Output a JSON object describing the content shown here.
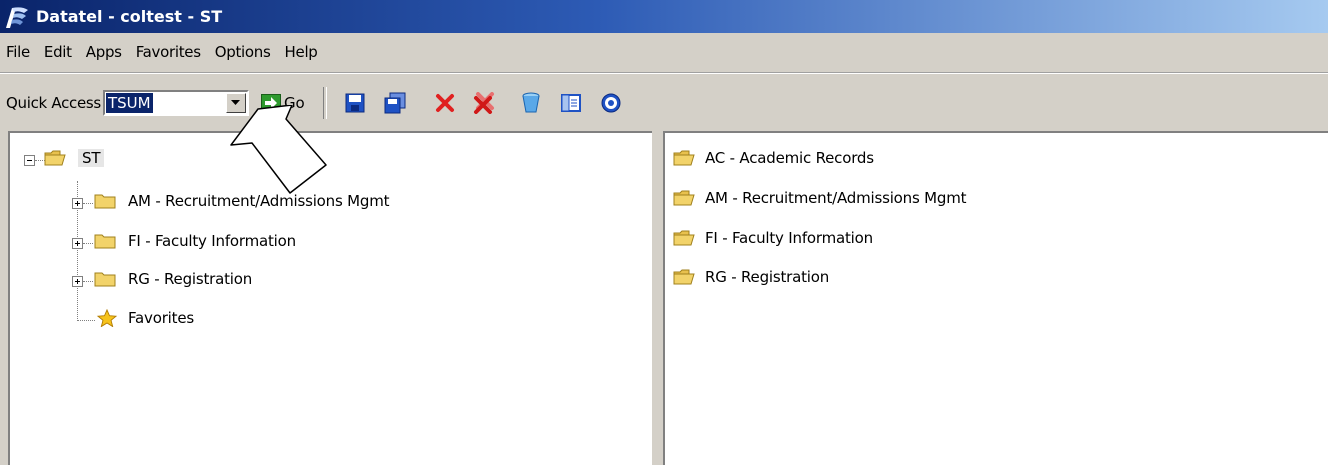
{
  "window": {
    "title": "Datatel - coltest - ST"
  },
  "menu": [
    "File",
    "Edit",
    "Apps",
    "Favorites",
    "Options",
    "Help"
  ],
  "toolbar": {
    "quick_access_label": "Quick Access",
    "quick_access_value": "TSUM",
    "go_label": "Go",
    "icons": [
      "save-icon",
      "save-all-icon",
      "cancel-icon",
      "cancel-all-icon",
      "delete-icon",
      "view-icon",
      "help-icon"
    ]
  },
  "tree": {
    "root": "ST",
    "items": [
      {
        "label": "AM - Recruitment/Admissions Mgmt"
      },
      {
        "label": "FI - Faculty Information"
      },
      {
        "label": "RG - Registration"
      },
      {
        "label": "Favorites"
      }
    ]
  },
  "list": {
    "items": [
      {
        "label": "AC - Academic Records"
      },
      {
        "label": "AM - Recruitment/Admissions Mgmt"
      },
      {
        "label": "FI - Faculty Information"
      },
      {
        "label": "RG - Registration"
      }
    ]
  },
  "colors": {
    "title_start": "#0a246a",
    "title_end": "#a6caf0",
    "folder": "#f2d36a",
    "selection": "#0a246a"
  }
}
